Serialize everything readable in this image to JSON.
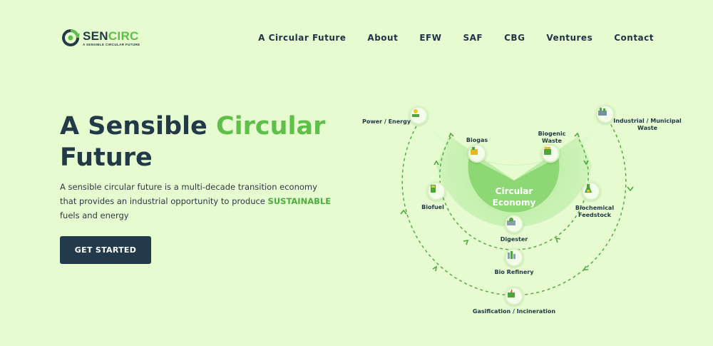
{
  "brand": {
    "name_part1": "SEN",
    "name_part2": "CIRC",
    "tagline": "A SENSIBLE CIRCULAR FUTURE",
    "colors": {
      "dark": "#223a48",
      "accent": "#5ec04a"
    }
  },
  "nav": {
    "items": [
      "A Circular Future",
      "About",
      "EFW",
      "SAF",
      "CBG",
      "Ventures",
      "Contact"
    ]
  },
  "hero": {
    "title_part1": "A Sensible ",
    "title_accent": "Circular",
    "title_part2": "Future",
    "desc_part1": "A sensible circular future is a multi-decade transition economy that provides an industrial opportunity to produce ",
    "desc_highlight": "SUSTAINABLE",
    "desc_part2": " fuels and energy",
    "cta_label": "GET STARTED"
  },
  "diagram": {
    "center_line1": "Circular",
    "center_line2": "Economy",
    "nodes": {
      "power": {
        "label": "Power / Energy",
        "icon": "sun-panel-icon"
      },
      "industrial": {
        "label_line1": "Industrial / Municipal",
        "label_line2": "Waste",
        "icon": "factory-icon"
      },
      "biogas": {
        "label": "Biogas",
        "icon": "gas-tank-icon"
      },
      "biogenic": {
        "label_line1": "Biogenic",
        "label_line2": "Waste",
        "icon": "waste-bin-icon"
      },
      "biofuel": {
        "label": "Biofuel",
        "icon": "fuel-pump-icon"
      },
      "biochemical": {
        "label_line1": "Biochemical",
        "label_line2": "Feedstock",
        "icon": "flask-icon"
      },
      "digester": {
        "label": "Digester",
        "icon": "digester-icon"
      },
      "biorefinery": {
        "label": "Bio Refinery",
        "icon": "refinery-icon"
      },
      "gasification": {
        "label": "Gasification / Incineration",
        "icon": "furnace-icon"
      }
    },
    "colors": {
      "inner": "#8fd977",
      "middle": "#c6f0b0",
      "outer": "#e1fad2",
      "dashed": "#4da63a"
    }
  }
}
